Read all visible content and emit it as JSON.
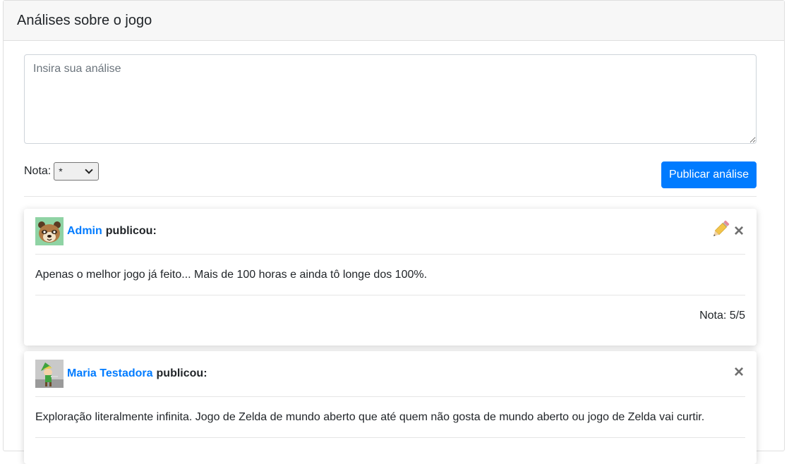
{
  "section": {
    "title": "Análises sobre o jogo"
  },
  "form": {
    "placeholder": "Insira sua análise",
    "rating_label": "Nota:",
    "rating_selected": "*",
    "publish_label": "Publicar análise"
  },
  "reviews": [
    {
      "author": "Admin",
      "action_text": "publicou:",
      "text": "Apenas o melhor jogo já feito... Mais de 100 horas e ainda tô longe dos 100%.",
      "score": "Nota: 5/5",
      "editable": true
    },
    {
      "author": "Maria Testadora",
      "action_text": "publicou:",
      "text": "Exploração literalmente infinita. Jogo de Zelda de mundo aberto que até quem não gosta de mundo aberto ou jogo de Zelda vai curtir.",
      "editable": false
    }
  ],
  "colors": {
    "link": "#007bff",
    "primary_button": "#007bff",
    "header_bg": "#f7f7f7"
  },
  "icons": {
    "edit": "pencil-icon",
    "delete": "close-icon"
  }
}
